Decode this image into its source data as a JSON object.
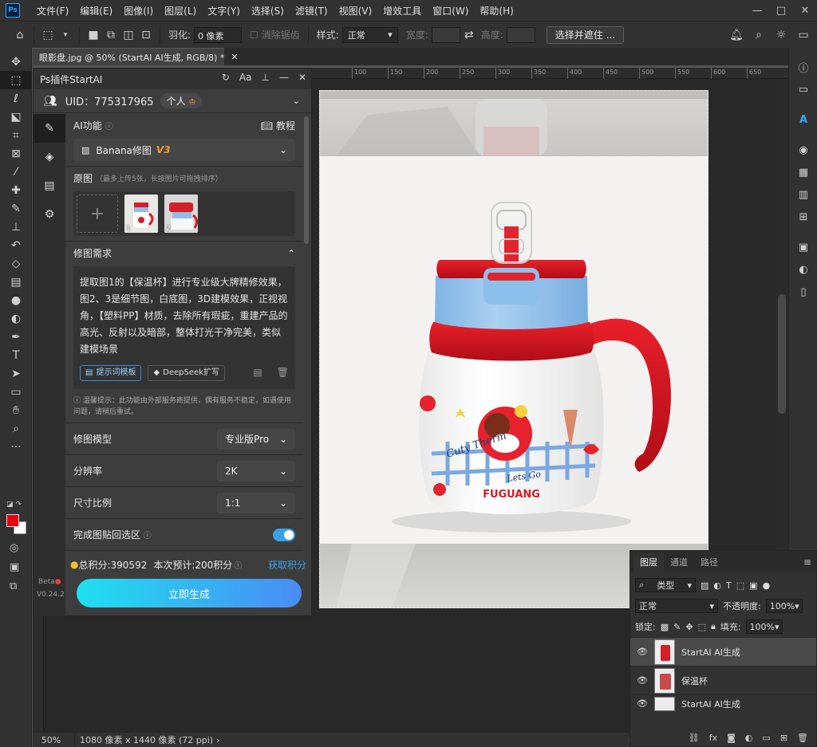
{
  "menu": {
    "logo": "Ps",
    "items": [
      "文件(F)",
      "编辑(E)",
      "图像(I)",
      "图层(L)",
      "文字(Y)",
      "选择(S)",
      "滤镜(T)",
      "视图(V)",
      "增效工具",
      "窗口(W)",
      "帮助(H)"
    ],
    "window_controls": [
      "—",
      "□",
      "✕"
    ]
  },
  "options": {
    "feather_label": "羽化:",
    "feather_value": "0 像素",
    "antialias_label": "消除锯齿",
    "style_label": "样式:",
    "style_value": "正常",
    "width_label": "宽度:",
    "height_label": "高度:",
    "select_mask_button": "选择并遮住 ..."
  },
  "document": {
    "tab_title": "眼影盘.jpg @ 50% (StartAI AI生成, RGB/8) *",
    "zoom": "50%",
    "size_info": "1080 像素 x 1440 像素 (72 ppi)",
    "ruler_ticks": [
      "100",
      "150",
      "200",
      "250",
      "300",
      "350",
      "400",
      "450",
      "500",
      "550",
      "600",
      "650"
    ]
  },
  "plugin": {
    "title": "Ps插件StartAI",
    "uid": "UID：775317965",
    "account_type": "个人",
    "ai_function_label": "AI功能",
    "tutorial_label": "教程",
    "function_value": "Banana修图",
    "function_version": "V3",
    "source_label": "原图",
    "source_hint": "（最多上传5张，长按图片可拖拽排序）",
    "thumb_numbers": [
      "1",
      "2"
    ],
    "requirement_label": "修图需求",
    "requirement_text": "提取图1的【保温杯】进行专业级大牌精修效果，图2、3是细节图，白底图，3D建模效果，正视视角，【塑料PP】材质，去除所有瑕疵，重建产品的高光、反射以及暗部，整体打光干净完美，类似建模场景",
    "prompt_template_btn": "提示词模板",
    "deepseek_btn": "DeepSeek扩写",
    "tip": "温馨提示：此功能由外部服务商提供，偶有服务不稳定，如遇使用问题，请稍后重试。",
    "model_label": "修图模型",
    "model_value": "专业版Pro",
    "resolution_label": "分辨率",
    "resolution_value": "2K",
    "ratio_label": "尺寸比例",
    "ratio_value": "1:1",
    "paste_back_label": "完成图贴回选区",
    "paste_back_on": true,
    "points_total": "总积分:390592",
    "points_estimate": "本次预计:200积分",
    "get_points": "获取积分",
    "generate_btn": "立即生成",
    "beta_label": "Beta",
    "version": "V0.24.2"
  },
  "layers_panel": {
    "tabs": [
      "图层",
      "通道",
      "路径"
    ],
    "filter_value": "类型",
    "blend_mode": "正常",
    "opacity_label": "不透明度:",
    "opacity_value": "100%",
    "lock_label": "锁定:",
    "fill_label": "填充:",
    "fill_value": "100%",
    "layers": [
      "StartAI AI生成",
      "保温杯",
      "StartAI AI生成"
    ]
  },
  "product": {
    "brand_text": "FUGUANG",
    "script_text": "Lets Go",
    "script_text2": "Cuty Therm"
  },
  "colors": {
    "foreground": "#e60012",
    "background": "#ffffff",
    "accent": "#31a8ff",
    "points_link": "#3aa0e8"
  }
}
